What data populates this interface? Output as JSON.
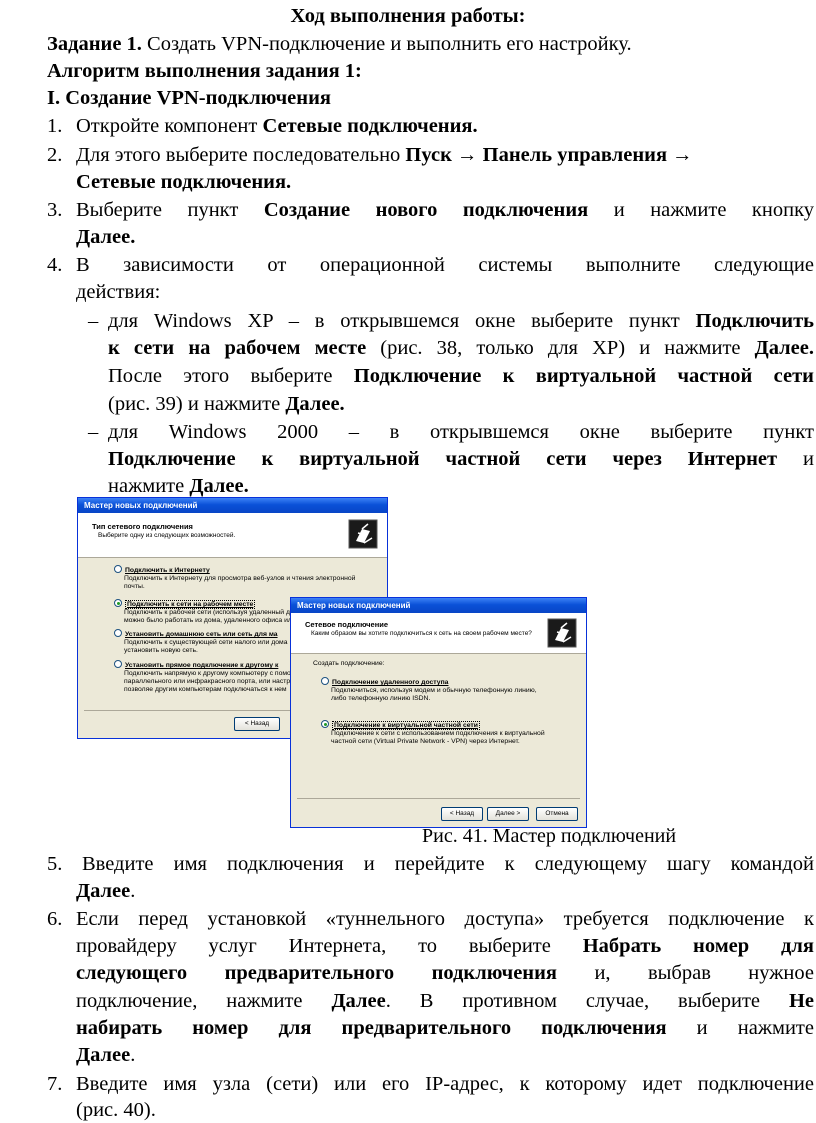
{
  "heading": "Ход выполнения работы:",
  "task1": {
    "label": "Задание 1.",
    "text": " Создать VPN-подключение и выполнить его настройку."
  },
  "algorithm": "Алгоритм выполнения задания 1:",
  "section1": "I. Создание VPN-подключения",
  "steps": {
    "s1": {
      "num": "1.",
      "text": "Откройте компонент ",
      "bold": "Сетевые подключения."
    },
    "s2": {
      "num": "2.",
      "text": "Для этого выберите последовательно ",
      "bold": "Пуск → Панель управления →",
      "bold2": "Сетевые подключения."
    },
    "s3": {
      "num": "3.",
      "l1_a": "Выберите пункт ",
      "l1_b": "Создание нового подключения",
      "l1_c": " и нажмите кнопку",
      "l2": "Далее."
    },
    "s4": {
      "num": "4.",
      "l1": "В зависимости от операционной системы выполните следующие",
      "l2": "действия:"
    },
    "b1": {
      "dash": "–",
      "l1_a": "для Windows XP – в открывшемся окне выберите пункт ",
      "l1_b": "Подключить",
      "l2_a": "к сети на рабочем месте",
      "l2_b": " (рис. 38, только для XP) и нажмите ",
      "l2_c": "Далее.",
      "l3_a": "После этого выберите ",
      "l3_b": "Подключение к виртуальной частной сети",
      "l4_a": "(рис. 39) и нажмите ",
      "l4_b": "Далее."
    },
    "b2": {
      "dash": "–",
      "l1": "для Windows 2000 – в открывшемся окне выберите пункт",
      "l2_a": "Подключение к виртуальной частной сети через Интернет",
      "l2_b": " и",
      "l3_a": "нажмите ",
      "l3_b": "Далее."
    },
    "s5": {
      "num": "5.",
      "l1": "Введите имя подключения и перейдите к следующему шагу командой",
      "l2": "Далее",
      "l2_end": "."
    },
    "s6": {
      "num": "6.",
      "l1": "Если перед установкой «туннельного доступа» требуется подключение к",
      "l2_a": "провайдеру услуг Интернета, то выберите ",
      "l2_b": "Набрать номер для",
      "l3_a": "следующего предварительного подключения",
      "l3_b": " и, выбрав нужное",
      "l4_a": "подключение, нажмите ",
      "l4_b": "Далее",
      "l4_c": ". В противном случае, выберите ",
      "l4_d": "Не",
      "l5_a": "набирать номер для предварительного подключения",
      "l5_b": " и нажмите",
      "l6_a": "Далее",
      "l6_b": "."
    },
    "s7": {
      "num": "7.",
      "l1": "Введите имя узла (сети) или его IP-адрес, к которому идет подключение",
      "l2": "(рис. 40)."
    }
  },
  "figure_caption": "Рис. 41. Мастер подключений",
  "dialog1": {
    "title": "Мастер новых подключений",
    "header_title": "Тип сетевого подключения",
    "header_sub": "Выберите одну из следующих возможностей.",
    "options": [
      {
        "title": "Подключить к Интернету",
        "desc1": "Подключить к Интернету для просмотра веб-узлов и чтения  электронной",
        "desc2": "почты."
      },
      {
        "title": "Подключить к сети на рабочем месте",
        "desc1": "Подключить к рабочей сети (используя удаленный д",
        "desc2": "можно было работать из дома, удаленного офиса ил"
      },
      {
        "title": "Установить домашнюю сеть или сеть для ма",
        "desc1": "Подключить к существующей сети налого или дома",
        "desc2": "установить новую сеть."
      },
      {
        "title": "Установить прямое подключение к другому к",
        "desc1": "Подключить напрямую к другому компьютеру с помо",
        "desc2": "параллельного или инфракрасного порта, или настр",
        "desc3": "позволяе другим  компьютерам подключаться к нем"
      }
    ],
    "back_button": "< Назад"
  },
  "dialog2": {
    "title": "Мастер новых подключений",
    "header_title": "Сетевое подключение",
    "header_sub": "Каким образом вы хотите подключиться к сеть на своем рабочем месте?",
    "group_label": "Создать подключение:",
    "options": [
      {
        "title": "Подключение удаленного доступа",
        "desc1": "Подключиться, используя модем и обычную телефонную линию,",
        "desc2": "либо телефонную линию ISDN."
      },
      {
        "title": "Подключение к виртуальной частной сети",
        "desc1": "Подключение к сети с использованием подключения к виртуальной",
        "desc2": "частной сети (Virtual Private Network - VPN) через Интернет."
      }
    ],
    "back_button": "< Назад",
    "next_button": "Далее >",
    "cancel_button": "Отмена"
  }
}
